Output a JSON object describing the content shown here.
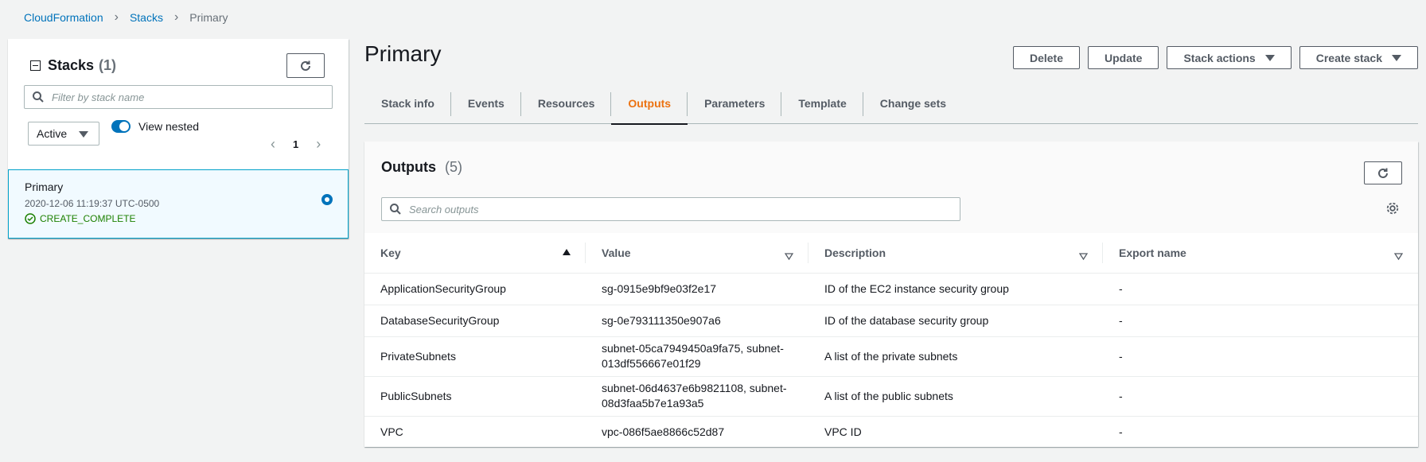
{
  "breadcrumb": {
    "root": "CloudFormation",
    "stacks": "Stacks",
    "current": "Primary"
  },
  "left": {
    "title": "Stacks",
    "count": "(1)",
    "search_placeholder": "Filter by stack name",
    "filter_value": "Active",
    "toggle_label": "View nested",
    "toggle_on": true,
    "page": "1",
    "stack": {
      "name": "Primary",
      "date": "2020-12-06 11:19:37 UTC-0500",
      "status": "CREATE_COMPLETE"
    }
  },
  "main": {
    "title": "Primary",
    "actions": {
      "delete": "Delete",
      "update": "Update",
      "stack_actions": "Stack actions",
      "create_stack": "Create stack"
    },
    "tabs": [
      {
        "label": "Stack info"
      },
      {
        "label": "Events"
      },
      {
        "label": "Resources"
      },
      {
        "label": "Outputs",
        "active": true
      },
      {
        "label": "Parameters"
      },
      {
        "label": "Template"
      },
      {
        "label": "Change sets"
      }
    ],
    "outputs": {
      "title": "Outputs",
      "count": "(5)",
      "search_placeholder": "Search outputs",
      "columns": [
        "Key",
        "Value",
        "Description",
        "Export name"
      ],
      "rows": [
        {
          "key": "ApplicationSecurityGroup",
          "value": "sg-0915e9bf9e03f2e17",
          "description": "ID of the EC2 instance security group",
          "export": "-"
        },
        {
          "key": "DatabaseSecurityGroup",
          "value": "sg-0e793111350e907a6",
          "description": "ID of the database security group",
          "export": "-"
        },
        {
          "key": "PrivateSubnets",
          "value": "subnet-05ca7949450a9fa75, subnet-013df556667e01f29",
          "description": "A list of the private subnets",
          "export": "-"
        },
        {
          "key": "PublicSubnets",
          "value": "subnet-06d4637e6b9821108, subnet-08d3faa5b7e1a93a5",
          "description": "A list of the public subnets",
          "export": "-"
        },
        {
          "key": "VPC",
          "value": "vpc-086f5ae8866c52d87",
          "description": "VPC ID",
          "export": "-"
        }
      ]
    }
  },
  "colors": {
    "link": "#0073bb",
    "active_tab": "#ec7211",
    "success": "#1d8102",
    "selected_bg": "#f1faff"
  }
}
